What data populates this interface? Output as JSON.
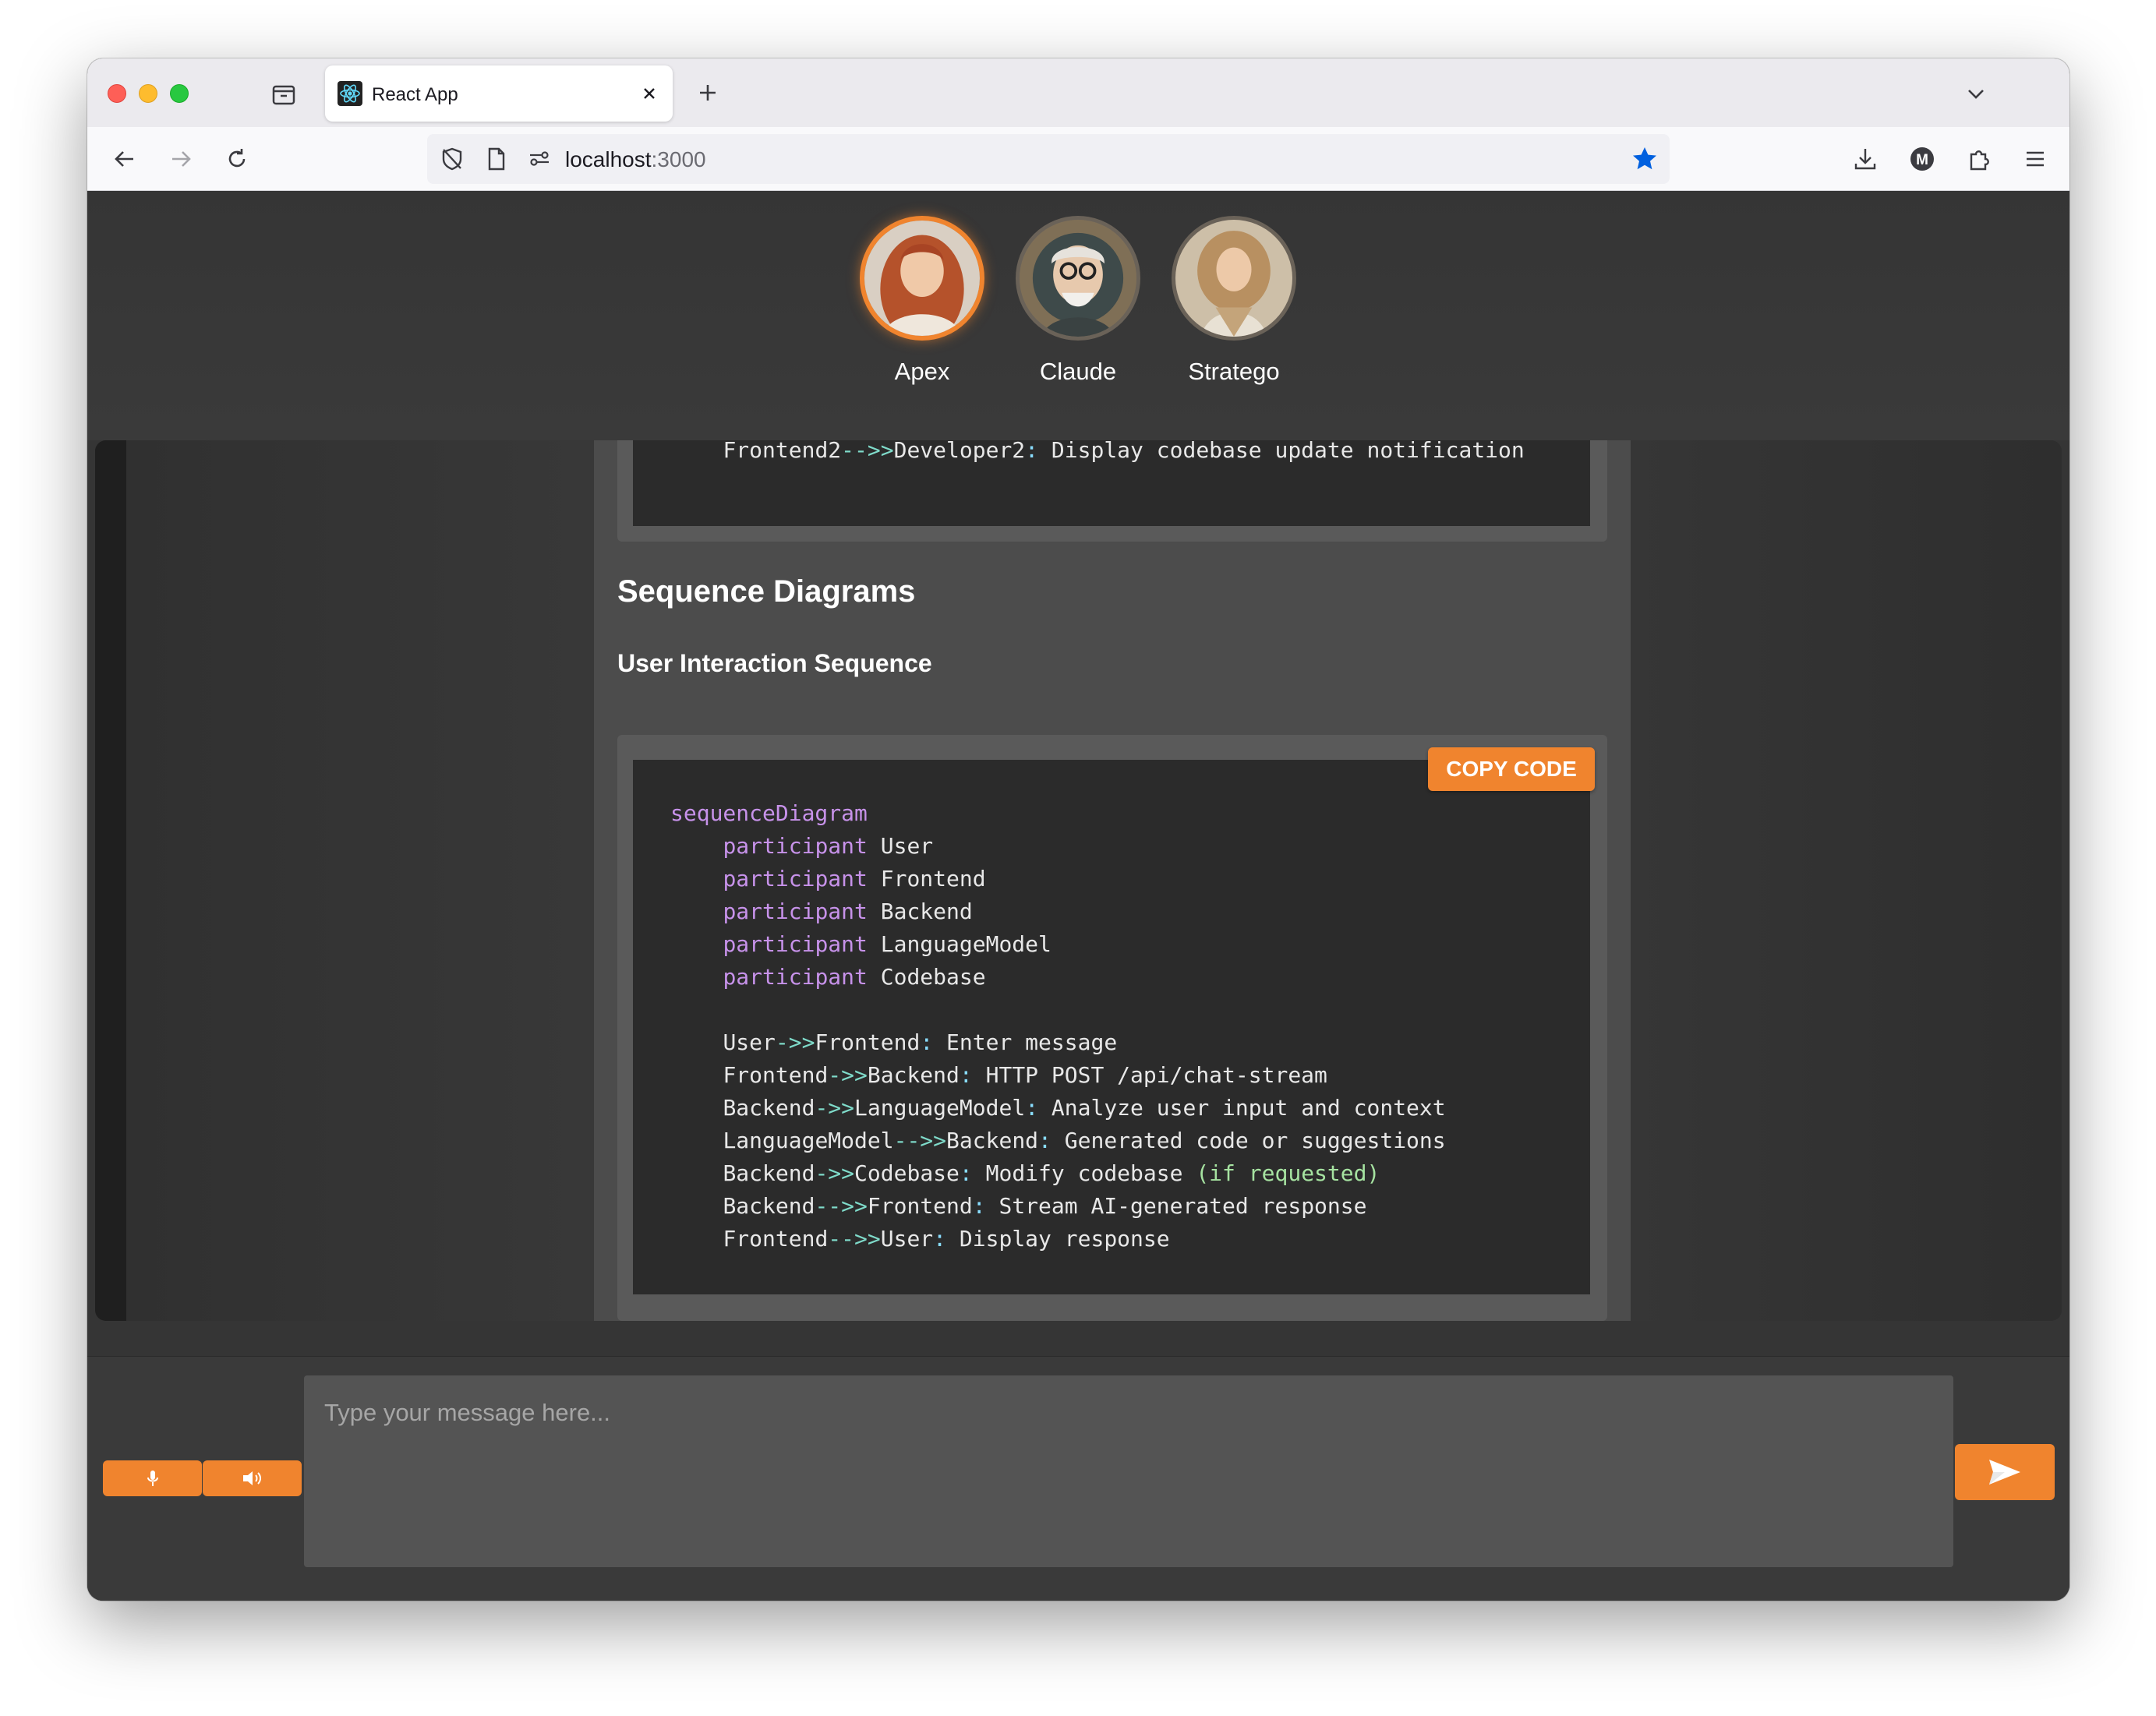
{
  "browser": {
    "tab_title": "React App",
    "url_host": "localhost",
    "url_port": ":3000"
  },
  "agents": [
    {
      "name": "Apex",
      "active": true
    },
    {
      "name": "Claude",
      "active": false
    },
    {
      "name": "Stratego",
      "active": false
    }
  ],
  "chat": {
    "top_code_lines": [
      {
        "indent": "    ",
        "a": "Frontend2",
        "arrow": "-->>",
        "b": "Developer2",
        "colon": ":",
        "text": " Display codebase update notification"
      }
    ],
    "section_heading": "Sequence Diagrams",
    "subsection_heading": "User Interaction Sequence",
    "copy_button_label": "COPY CODE",
    "code": {
      "header": "sequenceDiagram",
      "participants_keyword": "participant",
      "participants": [
        "User",
        "Frontend",
        "Backend",
        "LanguageModel",
        "Codebase"
      ],
      "messages": [
        {
          "from": "User",
          "arrow": "->>",
          "to": "Frontend",
          "text": " Enter message",
          "extra": ""
        },
        {
          "from": "Frontend",
          "arrow": "->>",
          "to": "Backend",
          "text": " HTTP POST /api/chat-stream",
          "extra": ""
        },
        {
          "from": "Backend",
          "arrow": "->>",
          "to": "LanguageModel",
          "text": " Analyze user input and context",
          "extra": ""
        },
        {
          "from": "LanguageModel",
          "arrow": "-->>",
          "to": "Backend",
          "text": " Generated code or suggestions",
          "extra": ""
        },
        {
          "from": "Backend",
          "arrow": "->>",
          "to": "Codebase",
          "text": " Modify codebase ",
          "extra": "(if requested)"
        },
        {
          "from": "Backend",
          "arrow": "-->>",
          "to": "Frontend",
          "text": " Stream AI-generated response",
          "extra": ""
        },
        {
          "from": "Frontend",
          "arrow": "-->>",
          "to": "User",
          "text": " Display response",
          "extra": ""
        }
      ]
    }
  },
  "composer": {
    "placeholder": "Type your message here..."
  },
  "colors": {
    "accent": "#f0842e",
    "code_keyword": "#c792ea",
    "code_arrow": "#7fdbca",
    "code_string": "#a6e3a1"
  }
}
